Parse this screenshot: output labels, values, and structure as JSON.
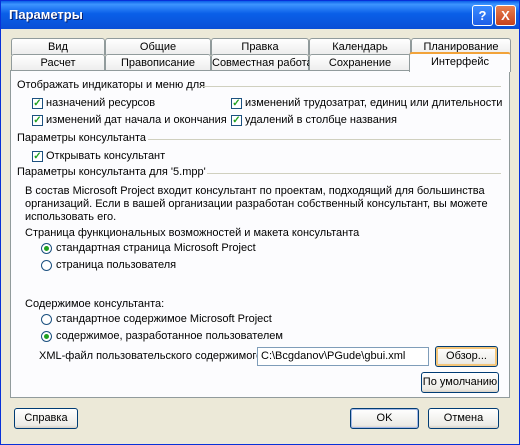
{
  "window": {
    "title": "Параметры"
  },
  "titlebar_buttons": {
    "help": "?",
    "close": "X"
  },
  "tabs_back": [
    "Вид",
    "Общие",
    "Правка",
    "Календарь",
    "Планирование"
  ],
  "tabs_front": [
    "Расчет",
    "Правописание",
    "Совместная работа",
    "Сохранение",
    "Интерфейс"
  ],
  "active_tab": "Интерфейс",
  "section_indicators": {
    "title": "Отображать индикаторы и меню для",
    "items": [
      {
        "label": "назначений ресурсов",
        "checked": true
      },
      {
        "label": "изменений трудозатрат, единиц или длительности",
        "checked": true
      },
      {
        "label": "изменений дат начала и окончания",
        "checked": true
      },
      {
        "label": "удалений в столбце названия",
        "checked": true
      }
    ]
  },
  "section_advisor": {
    "title": "Параметры консультанта",
    "items": [
      {
        "label": "Открывать консультант",
        "checked": true
      }
    ]
  },
  "section_project": {
    "title": "Параметры консультанта для '5.mpp'",
    "description": [
      "В состав Microsoft Project входит консультант по проектам, подходящий для большинства",
      "организаций. Если в вашей организации разработан собственный консультант, вы можете",
      "использовать его."
    ],
    "layout_label": "Страница функциональных возможностей и макета консультанта",
    "layout_options": [
      {
        "label": "стандартная страница Microsoft Project",
        "selected": true
      },
      {
        "label": "страница пользователя",
        "selected": false
      }
    ],
    "content_label": "Содержимое консультанта:",
    "content_options": [
      {
        "label": "стандартное содержимое Microsoft Project",
        "selected": false
      },
      {
        "label": "содержимое, разработанное пользователем",
        "selected": true
      }
    ],
    "xml_label": "XML-файл пользовательского содержимого:",
    "xml_value": "C:\\Bcgdanov\\PGude\\gbui.xml",
    "browse_button": "Обзор...",
    "defaults_button": "По умолчанию"
  },
  "footer": {
    "help": "Справка",
    "ok": "OK",
    "cancel": "Отмена"
  }
}
